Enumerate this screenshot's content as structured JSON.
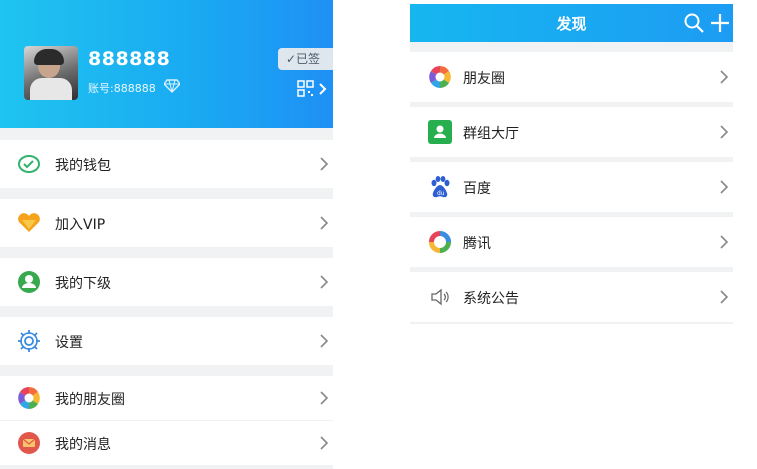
{
  "colors": {
    "header_gradient_start": "#1fc4f0",
    "header_gradient_end": "#1e90f5",
    "background": "#f1f2f4"
  },
  "me": {
    "username": "888888",
    "account": "账号:888888",
    "sign_label": "✓已签",
    "menu": [
      {
        "label": "我的钱包",
        "icon": "wallet-icon"
      },
      {
        "label": "加入VIP",
        "icon": "vip-heart-icon"
      },
      {
        "label": "我的下级",
        "icon": "subordinate-user-icon"
      },
      {
        "label": "设置",
        "icon": "gear-icon"
      },
      {
        "label": "我的朋友圈",
        "icon": "moments-aperture-icon"
      },
      {
        "label": "我的消息",
        "icon": "message-icon"
      }
    ]
  },
  "discover": {
    "title": "发现",
    "items": [
      {
        "label": "朋友圈",
        "icon": "moments-aperture-icon"
      },
      {
        "label": "群组大厅",
        "icon": "group-hall-icon"
      },
      {
        "label": "百度",
        "icon": "baidu-paw-icon"
      },
      {
        "label": "腾讯",
        "icon": "tencent-icon"
      },
      {
        "label": "系统公告",
        "icon": "speaker-icon"
      }
    ]
  }
}
